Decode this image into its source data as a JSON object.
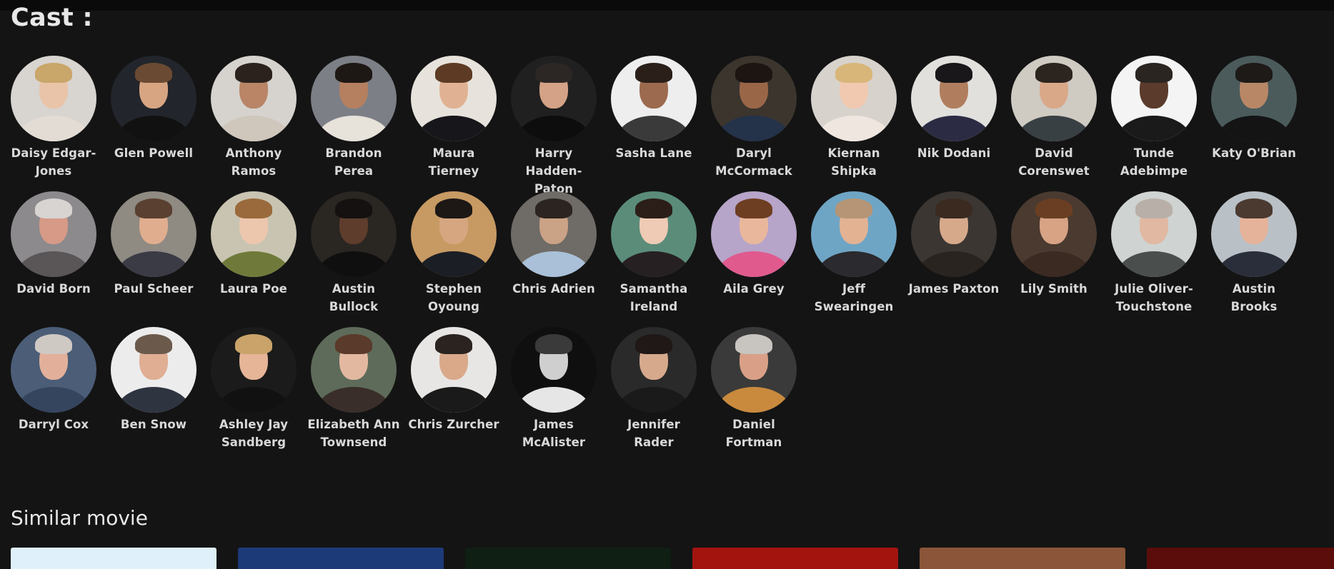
{
  "cast": {
    "title": "Cast :",
    "members": [
      {
        "name": "Daisy Edgar-Jones",
        "bg": "#d8d4d0",
        "skin": "#e9c4a8",
        "hair": "#c9a66a",
        "cloth": "#e3dcd4"
      },
      {
        "name": "Glen Powell",
        "bg": "#22252b",
        "skin": "#d8a583",
        "hair": "#6a4a32",
        "cloth": "#111111"
      },
      {
        "name": "Anthony Ramos",
        "bg": "#d6d3cf",
        "skin": "#b98566",
        "hair": "#2b221d",
        "cloth": "#cfc6bc"
      },
      {
        "name": "Brandon Perea",
        "bg": "#7c7f86",
        "skin": "#b5805f",
        "hair": "#1e1814",
        "cloth": "#e7e2da"
      },
      {
        "name": "Maura Tierney",
        "bg": "#e7e3dc",
        "skin": "#e0b293",
        "hair": "#5d3a24",
        "cloth": "#17161a"
      },
      {
        "name": "Harry Hadden-Paton",
        "bg": "#202020",
        "skin": "#d4a287",
        "hair": "#2c2724",
        "cloth": "#0d0d0d"
      },
      {
        "name": "Sasha Lane",
        "bg": "#eeeeee",
        "skin": "#9c6a4e",
        "hair": "#2a1f19",
        "cloth": "#3a3a3a"
      },
      {
        "name": "Daryl McCormack",
        "bg": "#3b352e",
        "skin": "#9a6648",
        "hair": "#1c1512",
        "cloth": "#24324a"
      },
      {
        "name": "Kiernan Shipka",
        "bg": "#d7d2cc",
        "skin": "#f0c9b0",
        "hair": "#d8b67a",
        "cloth": "#efe6e0"
      },
      {
        "name": "Nik Dodani",
        "bg": "#e2e0dd",
        "skin": "#b07e5e",
        "hair": "#19171a",
        "cloth": "#2b2c44"
      },
      {
        "name": "David Corenswet",
        "bg": "#cfcac2",
        "skin": "#d9a889",
        "hair": "#2c241e",
        "cloth": "#394044"
      },
      {
        "name": "Tunde Adebimpe",
        "bg": "#f4f4f4",
        "skin": "#5b3b2b",
        "hair": "#2b2522",
        "cloth": "#1a1a1a"
      },
      {
        "name": "Katy O'Brian",
        "bg": "#4b5b5c",
        "skin": "#b88766",
        "hair": "#1e1a17",
        "cloth": "#141414"
      },
      {
        "name": "David Born",
        "bg": "#8c8a8d",
        "skin": "#d69a86",
        "hair": "#d7d4d2",
        "cloth": "#5a5556"
      },
      {
        "name": "Paul Scheer",
        "bg": "#8f8a82",
        "skin": "#e0ad8f",
        "hair": "#5a4030",
        "cloth": "#3a3b45"
      },
      {
        "name": "Laura Poe",
        "bg": "#c9c4b1",
        "skin": "#edc7ad",
        "hair": "#9a6a3c",
        "cloth": "#6f7a3a"
      },
      {
        "name": "Austin Bullock",
        "bg": "#2a2622",
        "skin": "#5e3d2c",
        "hair": "#141110",
        "cloth": "#0f0f0f"
      },
      {
        "name": "Stephen Oyoung",
        "bg": "#c79a63",
        "skin": "#d6a681",
        "hair": "#1d1816",
        "cloth": "#1b1e25"
      },
      {
        "name": "Chris Adrien",
        "bg": "#6f6b66",
        "skin": "#caa286",
        "hair": "#2b2420",
        "cloth": "#a9c0d8"
      },
      {
        "name": "Samantha Ireland",
        "bg": "#5b8c7a",
        "skin": "#efcab4",
        "hair": "#2b1e18",
        "cloth": "#272023"
      },
      {
        "name": "Aila Grey",
        "bg": "#b7a4c9",
        "skin": "#e9b89c",
        "hair": "#6e3e22",
        "cloth": "#e05a8e"
      },
      {
        "name": "Jeff Swearingen",
        "bg": "#6fa5c4",
        "skin": "#e2b293",
        "hair": "#b59575",
        "cloth": "#2b2a2e"
      },
      {
        "name": "James Paxton",
        "bg": "#3b3632",
        "skin": "#d6a98b",
        "hair": "#3a2a20",
        "cloth": "#2a2420"
      },
      {
        "name": "Lily Smith",
        "bg": "#4a3a30",
        "skin": "#d7a384",
        "hair": "#6a3e22",
        "cloth": "#3a2a22"
      },
      {
        "name": "Julie Oliver-Touchstone",
        "bg": "#cfd3d1",
        "skin": "#e1b8a2",
        "hair": "#b8b0a8",
        "cloth": "#4a4e4c"
      },
      {
        "name": "Austin Brooks",
        "bg": "#b9c0c6",
        "skin": "#e5b39a",
        "hair": "#4a3a30",
        "cloth": "#2a2e3a"
      },
      {
        "name": "Darryl Cox",
        "bg": "#4b5d77",
        "skin": "#e2b09a",
        "hair": "#cfc9c3",
        "cloth": "#35455d"
      },
      {
        "name": "Ben Snow",
        "bg": "#ececec",
        "skin": "#e0ae93",
        "hair": "#6b5a4c",
        "cloth": "#2e3440"
      },
      {
        "name": "Ashley Jay Sandberg",
        "bg": "#1b1b1b",
        "skin": "#e6b497",
        "hair": "#c9a36a",
        "cloth": "#111111"
      },
      {
        "name": "Elizabeth Ann Townsend",
        "bg": "#5e6b5a",
        "skin": "#e3b8a0",
        "hair": "#5a3a2a",
        "cloth": "#3a2e2a"
      },
      {
        "name": "Chris Zurcher",
        "bg": "#e8e6e4",
        "skin": "#d9a98a",
        "hair": "#2a2320",
        "cloth": "#1a1a1a"
      },
      {
        "name": "James McAlister",
        "bg": "#0f0f0f",
        "skin": "#cfcfcf",
        "hair": "#3a3a3a",
        "cloth": "#e6e6e6"
      },
      {
        "name": "Jennifer Rader",
        "bg": "#2a2a2a",
        "skin": "#d6a98c",
        "hair": "#1f1816",
        "cloth": "#1a1a1a"
      },
      {
        "name": "Daniel Fortman",
        "bg": "#3a3a3a",
        "skin": "#d9a087",
        "hair": "#c8c4c0",
        "cloth": "#c98a3e"
      }
    ]
  },
  "similar": {
    "title": "Similar movie",
    "movies": [
      {
        "name": "movie-1",
        "color": "#dff0fb"
      },
      {
        "name": "movie-2",
        "color": "#1d3a78"
      },
      {
        "name": "movie-3",
        "color": "#0f1f14"
      },
      {
        "name": "movie-4",
        "color": "#a3140f"
      },
      {
        "name": "movie-5",
        "color": "#8a5538"
      },
      {
        "name": "movie-6",
        "color": "#5a0d0a"
      }
    ]
  }
}
